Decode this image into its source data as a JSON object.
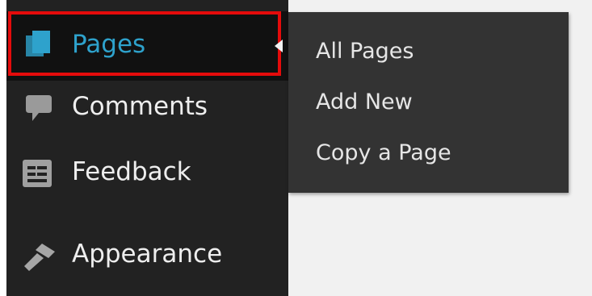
{
  "sidebar": {
    "items": [
      {
        "label": "Pages",
        "icon": "pages-icon",
        "active": true
      },
      {
        "label": "Comments",
        "icon": "comments-icon"
      },
      {
        "label": "Feedback",
        "icon": "feedback-icon"
      },
      {
        "label": "Appearance",
        "icon": "appearance-icon"
      }
    ]
  },
  "flyout": {
    "items": [
      {
        "label": "All Pages"
      },
      {
        "label": "Add New"
      },
      {
        "label": "Copy a Page"
      }
    ]
  },
  "colors": {
    "sidebar_bg": "#222222",
    "active_text": "#2ea2cc",
    "highlight_border": "#e50b0b",
    "flyout_bg": "#333333",
    "page_bg": "#f1f1f1"
  }
}
